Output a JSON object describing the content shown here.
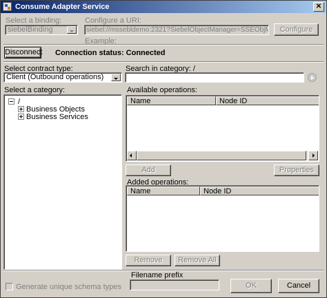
{
  "window": {
    "title": "Consume Adapter Service",
    "close_glyph": "✕"
  },
  "binding": {
    "label": "Select a binding:",
    "value": "siebelBinding"
  },
  "uri": {
    "label": "Configure a URI:",
    "value": "siebel://mssebldemo:2321?SiebelObjectManager=SSEObjMgr&SiebelEnterpri",
    "example_label": "Example:",
    "configure_button": "Configure"
  },
  "connection": {
    "disconnect_button": "Disconnect",
    "status_text": "Connection status: Connected"
  },
  "contract": {
    "label": "Select contract type:",
    "value": "Client (Outbound operations)"
  },
  "search": {
    "label": "Search in category: /",
    "value": ""
  },
  "category": {
    "label": "Select a category:",
    "tree": [
      {
        "label": "/",
        "expander": "minus"
      },
      {
        "label": "Business Objects",
        "expander": "plus"
      },
      {
        "label": "Business Services",
        "expander": "plus"
      }
    ]
  },
  "available": {
    "label": "Available operations:",
    "columns": [
      "Name",
      "Node ID"
    ],
    "add_button": "Add",
    "properties_button": "Properties"
  },
  "added": {
    "label": "Added operations:",
    "columns": [
      "Name",
      "Node ID"
    ],
    "remove_button": "Remove",
    "remove_all_button": "Remove All"
  },
  "footer": {
    "filename_label": "Filename prefix",
    "filename_value": "",
    "generate_label": "Generate unique schema types",
    "ok_button": "OK",
    "cancel_button": "Cancel"
  }
}
